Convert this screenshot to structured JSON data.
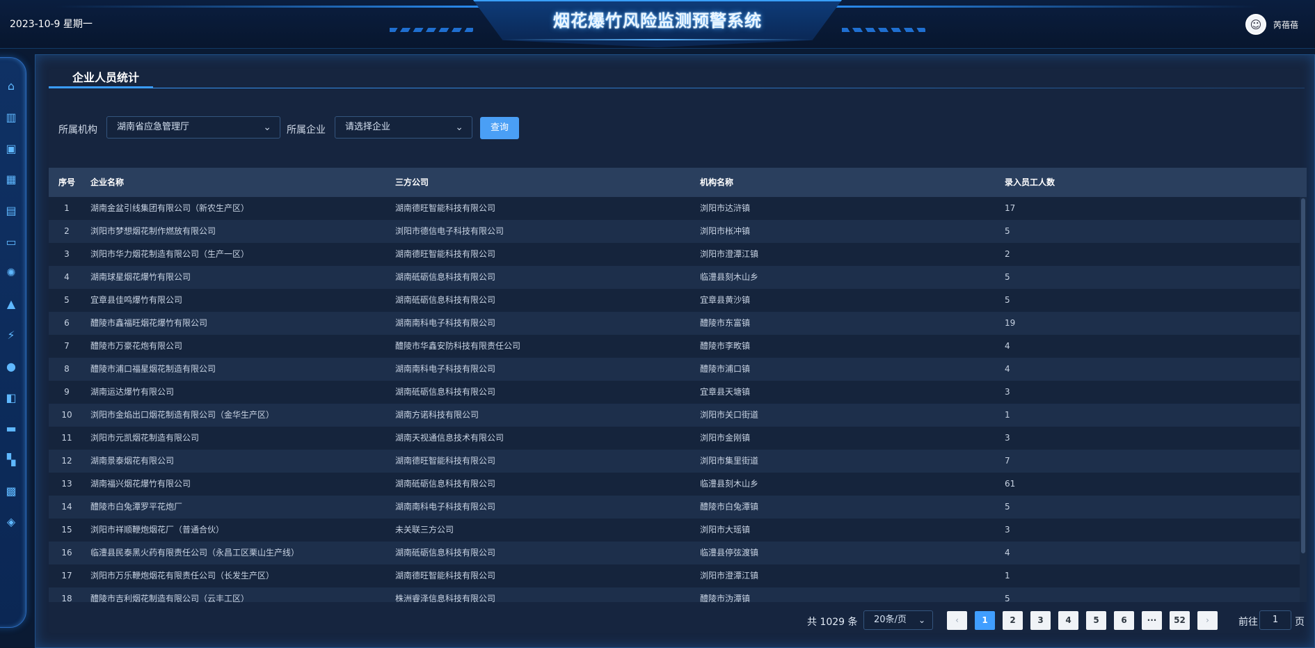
{
  "header": {
    "date": "2023-10-9 星期一",
    "title": "烟花爆竹风险监测预警系统",
    "user_name": "芮蓓蓓"
  },
  "sidebar": {
    "items": [
      {
        "icon": "home-icon"
      },
      {
        "icon": "building-icon"
      },
      {
        "icon": "briefcase-icon"
      },
      {
        "icon": "bar-chart-icon"
      },
      {
        "icon": "image-icon"
      },
      {
        "icon": "calendar-icon"
      },
      {
        "icon": "alarm-light-icon"
      },
      {
        "icon": "warning-icon"
      },
      {
        "icon": "power-icon"
      },
      {
        "icon": "lightbulb-icon"
      },
      {
        "icon": "document-search-icon"
      },
      {
        "icon": "monitor-chart-icon"
      },
      {
        "icon": "grid-icon"
      },
      {
        "icon": "stats-icon"
      },
      {
        "icon": "layers-icon"
      }
    ]
  },
  "page": {
    "title": "企业人员统计"
  },
  "filters": {
    "org_label": "所属机构",
    "org_value": "湖南省应急管理厅",
    "company_label": "所属企业",
    "company_placeholder": "请选择企业",
    "query_button": "查询"
  },
  "table": {
    "columns": [
      "序号",
      "企业名称",
      "三方公司",
      "机构名称",
      "录入员工人数"
    ],
    "rows": [
      [
        "1",
        "湖南金盆引线集团有限公司（新农生产区）",
        "湖南德旺智能科技有限公司",
        "浏阳市达浒镇",
        "17"
      ],
      [
        "2",
        "浏阳市梦想烟花制作燃放有限公司",
        "浏阳市德信电子科技有限公司",
        "浏阳市枨冲镇",
        "5"
      ],
      [
        "3",
        "浏阳市华力烟花制造有限公司（生产一区）",
        "湖南德旺智能科技有限公司",
        "浏阳市澄潭江镇",
        "2"
      ],
      [
        "4",
        "湖南球星烟花爆竹有限公司",
        "湖南砥砺信息科技有限公司",
        "临澧县刻木山乡",
        "5"
      ],
      [
        "5",
        "宜章县佳鸣爆竹有限公司",
        "湖南砥砺信息科技有限公司",
        "宜章县黄沙镇",
        "5"
      ],
      [
        "6",
        "醴陵市鑫福旺烟花爆竹有限公司",
        "湖南南科电子科技有限公司",
        "醴陵市东富镇",
        "19"
      ],
      [
        "7",
        "醴陵市万豪花炮有限公司",
        "醴陵市华鑫安防科技有限责任公司",
        "醴陵市李畋镇",
        "4"
      ],
      [
        "8",
        "醴陵市浦口福星烟花制造有限公司",
        "湖南南科电子科技有限公司",
        "醴陵市浦口镇",
        "4"
      ],
      [
        "9",
        "湖南运达爆竹有限公司",
        "湖南砥砺信息科技有限公司",
        "宜章县天塘镇",
        "3"
      ],
      [
        "10",
        "浏阳市金焰出口烟花制造有限公司（金华生产区）",
        "湖南方诺科技有限公司",
        "浏阳市关口街道",
        "1"
      ],
      [
        "11",
        "浏阳市元凯烟花制造有限公司",
        "湖南天视通信息技术有限公司",
        "浏阳市金刚镇",
        "3"
      ],
      [
        "12",
        "湖南景泰烟花有限公司",
        "湖南德旺智能科技有限公司",
        "浏阳市集里街道",
        "7"
      ],
      [
        "13",
        "湖南福兴烟花爆竹有限公司",
        "湖南砥砺信息科技有限公司",
        "临澧县刻木山乡",
        "61"
      ],
      [
        "14",
        "醴陵市白兔潭罗平花炮厂",
        "湖南南科电子科技有限公司",
        "醴陵市白兔潭镇",
        "5"
      ],
      [
        "15",
        "浏阳市祥顺鞭炮烟花厂（普通合伙）",
        "未关联三方公司",
        "浏阳市大瑶镇",
        "3"
      ],
      [
        "16",
        "临澧县民泰黑火药有限责任公司（永昌工区栗山生产线）",
        "湖南砥砺信息科技有限公司",
        "临澧县停弦渡镇",
        "4"
      ],
      [
        "17",
        "浏阳市万乐鞭炮烟花有限责任公司（长发生产区）",
        "湖南德旺智能科技有限公司",
        "浏阳市澄潭江镇",
        "1"
      ],
      [
        "18",
        "醴陵市吉利烟花制造有限公司（云丰工区）",
        "株洲睿泽信息科技有限公司",
        "醴陵市沩潭镇",
        "5"
      ]
    ]
  },
  "pagination": {
    "total_text": "共 1029 条",
    "page_size": "20条/页",
    "prev": "‹",
    "pages": [
      "1",
      "2",
      "3",
      "4",
      "5",
      "6",
      "···",
      "52"
    ],
    "active_page": "1",
    "next": "›",
    "goto_label": "前往",
    "goto_value": "1",
    "goto_suffix": "页"
  }
}
